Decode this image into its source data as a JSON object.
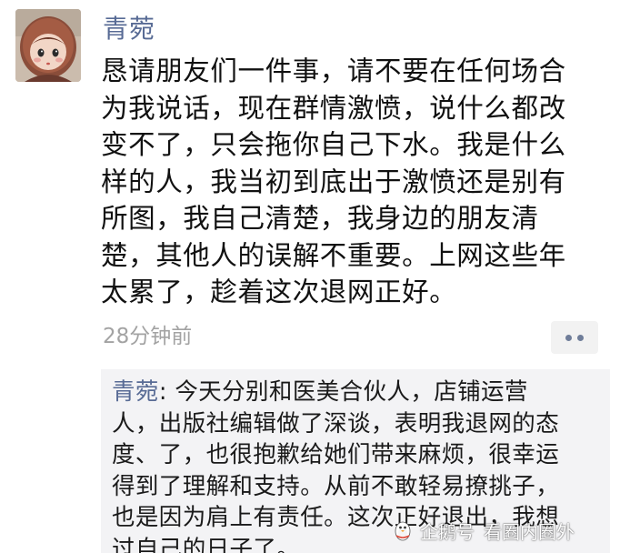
{
  "post": {
    "author": "青菀",
    "text": "恳请朋友们一件事，请不要在任何场合\n为我说话，现在群情激愤，说什么都改\n变不了，只会拖你自己下水。我是什么\n样的人，我当初到底出于激愤还是别有\n所图，我自己清楚，我身边的朋友清\n楚，其他人的误解不重要。上网这些年\n太累了，趁着这次退网正好。",
    "time": "28分钟前"
  },
  "comment": {
    "author": "青菀",
    "separator": ": ",
    "text": "今天分别和医美合伙人，店铺运营\n人，出版社编辑做了深谈，表明我退网的态\n度、了，也很抱歉给她们带来麻烦，很幸运\n得到了理解和支持。从前不敢轻易撩挑子，\n也是因为肩上有责任。这次正好退出，我想\n过自己的日子了。"
  },
  "watermark": {
    "platform": "企鹅号",
    "account": "看圈内圈外"
  },
  "icons": {
    "more": "more-dots-icon",
    "avatar": "doll-avatar-icon",
    "watermark_logo": "penguin-icon"
  },
  "colors": {
    "name_blue": "#586b95",
    "time_gray": "#a3a3a3",
    "comment_bg": "#f3f3f5"
  }
}
